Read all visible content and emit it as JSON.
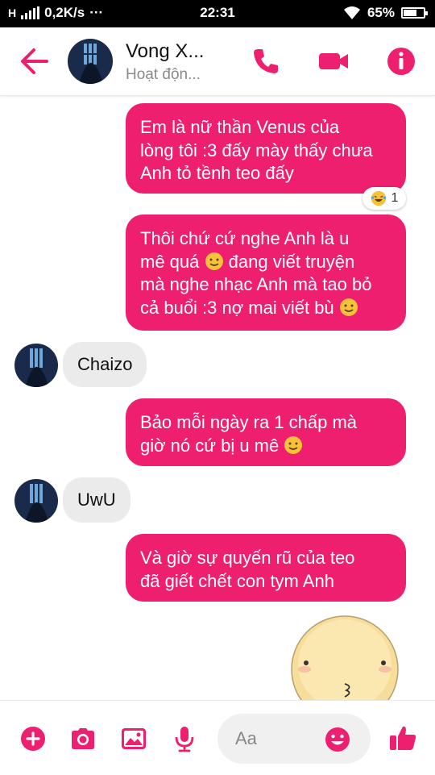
{
  "status_bar": {
    "network": "H",
    "speed": "0,2K/s",
    "dots": "···",
    "time": "22:31",
    "battery": "65%",
    "battery_level": 0.65
  },
  "header": {
    "name": "Vong X...",
    "status": "Hoạt độn...",
    "icons": [
      "back-arrow-icon",
      "phone-icon",
      "video-camera-icon",
      "info-icon"
    ]
  },
  "messages": [
    {
      "side": "outgoing",
      "lines": [
        "Em là nữ thần Venus của",
        "lòng tôi :3 đấy mày thấy chưa",
        "Anh tỏ tềnh teo đấy"
      ]
    },
    {
      "side": "outgoing",
      "lines": [
        "Thôi chứ cứ nghe Anh là u",
        "mê quá",
        "đang viết truyện",
        "mà nghe nhạc Anh mà tao bỏ",
        "cả buổi :3 nợ mai viết bù"
      ]
    },
    {
      "side": "incoming",
      "text": "Chaizo"
    },
    {
      "side": "outgoing",
      "lines": [
        "Bảo mỗi ngày ra 1 chấp mà",
        "giờ nó cứ bị u mê"
      ]
    },
    {
      "side": "incoming",
      "text": "UwU"
    },
    {
      "side": "outgoing",
      "lines": [
        "Và giờ sự quyến rũ của teo",
        "đã giết chết con tym Anh"
      ]
    }
  ],
  "reaction": {
    "emoji": "laughing-tears-icon",
    "count": "1"
  },
  "composer": {
    "placeholder": "Aa",
    "icons": [
      "plus-icon",
      "camera-icon",
      "image-icon",
      "microphone-icon",
      "smile-icon",
      "thumbs-up-icon"
    ]
  },
  "colors": {
    "accent": "#ee1f6e",
    "incoming_bubble": "#ebebeb",
    "status_bar": "#000000"
  }
}
